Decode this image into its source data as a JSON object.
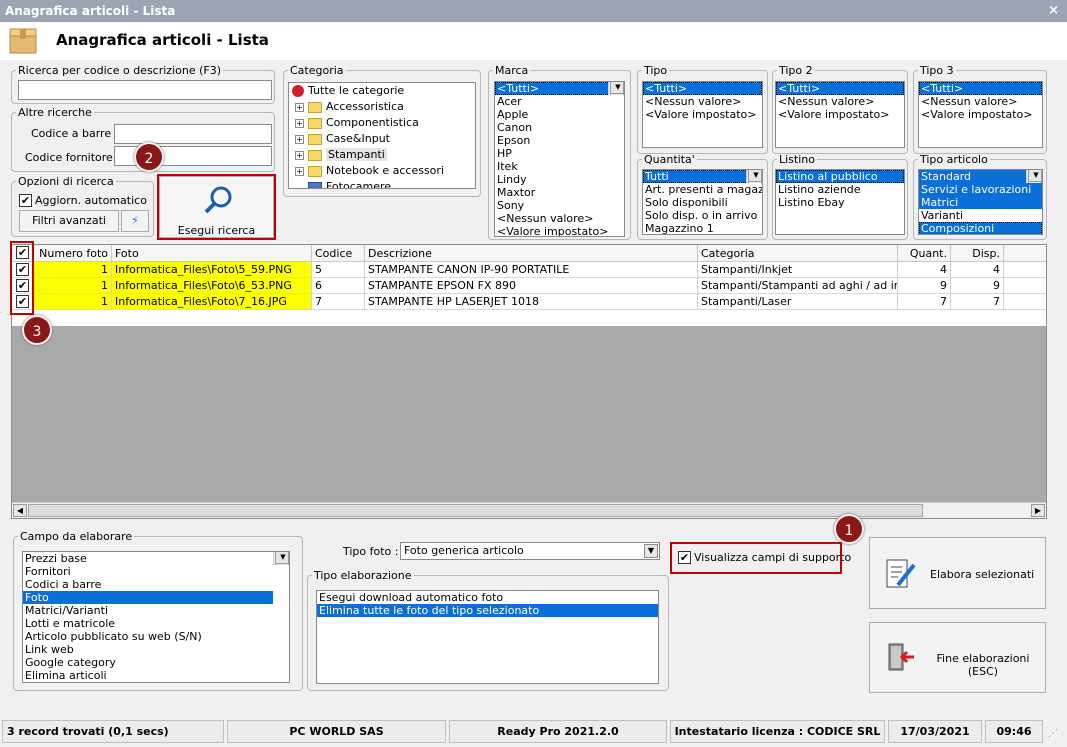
{
  "window": {
    "title": "Anagrafica articoli  - Lista",
    "close": "×"
  },
  "header": {
    "title": "Anagrafica articoli  - Lista"
  },
  "search": {
    "legend": "Ricerca per codice o descrizione (F3)",
    "value": ""
  },
  "other": {
    "legend": "Altre ricerche",
    "barcode_label": "Codice a barre :",
    "supplier_label": "Codice fornitore :"
  },
  "options": {
    "legend": "Opzioni di ricerca",
    "auto_label": "Aggiorn. automatico",
    "adv_label": "Filtri avanzati",
    "lightning": "⚡"
  },
  "run_search": {
    "label": "Esegui ricerca"
  },
  "category": {
    "legend": "Categoria",
    "items": [
      "Tutte le categorie",
      "Accessoristica",
      "Componentistica",
      "Case&Input",
      "Stampanti",
      "Notebook e accessori",
      "Fotocamere"
    ]
  },
  "brand": {
    "legend": "Marca",
    "items": [
      "<Tutti>",
      "Acer",
      "Apple",
      "Canon",
      "Epson",
      "HP",
      "Itek",
      "Lindy",
      "Maxtor",
      "Sony",
      "<Nessun valore>",
      "<Valore impostato>"
    ]
  },
  "tipo": {
    "legend": "Tipo",
    "items": [
      "<Tutti>",
      "<Nessun valore>",
      "<Valore impostato>"
    ]
  },
  "tipo2": {
    "legend": "Tipo 2",
    "items": [
      "<Tutti>",
      "<Nessun valore>",
      "<Valore impostato>"
    ]
  },
  "tipo3": {
    "legend": "Tipo 3",
    "items": [
      "<Tutti>",
      "<Nessun valore>",
      "<Valore impostato>"
    ]
  },
  "quantity": {
    "legend": "Quantita'",
    "items": [
      "Tutti",
      "Art. presenti a magazzino",
      "Solo disponibili",
      "Solo disp. o in arrivo",
      "Magazzino 1"
    ]
  },
  "pricelist": {
    "legend": "Listino",
    "items": [
      "Listino al pubblico",
      "Listino aziende",
      "Listino Ebay"
    ]
  },
  "article_type": {
    "legend": "Tipo articolo",
    "items": [
      "Standard",
      "Servizi e lavorazioni",
      "Matrici",
      "Varianti",
      "Composizioni"
    ]
  },
  "grid": {
    "columns": [
      "Numero foto",
      "Foto",
      "Codice",
      "Descrizione",
      "Categoria",
      "Quant.",
      "Disp."
    ],
    "rows": [
      {
        "n": "1",
        "foto": "Informatica_Files\\Foto\\5_59.PNG",
        "code": "5",
        "desc": "STAMPANTE CANON IP-90 PORTATILE",
        "cat": "Stampanti/Inkjet",
        "q": "4",
        "d": "4"
      },
      {
        "n": "1",
        "foto": "Informatica_Files\\Foto\\6_53.PNG",
        "code": "6",
        "desc": "STAMPANTE EPSON FX 890",
        "cat": "Stampanti/Stampanti ad aghi / ad imp...",
        "q": "9",
        "d": "9"
      },
      {
        "n": "1",
        "foto": "Informatica_Files\\Foto\\7_16.JPG",
        "code": "7",
        "desc": "STAMPANTE HP LASERJET 1018",
        "cat": "Stampanti/Laser",
        "q": "7",
        "d": "7"
      }
    ]
  },
  "field": {
    "legend": "Campo da elaborare",
    "items": [
      "Prezzi base",
      "Fornitori",
      "Codici a barre",
      "Foto",
      "Matrici/Varianti",
      "Lotti e matricole",
      "Articolo pubblicato su web (S/N)",
      "Link web",
      "Google category",
      "Elimina articoli"
    ]
  },
  "photo_type": {
    "label": "Tipo foto :",
    "value": "Foto generica articolo"
  },
  "support": {
    "label": "Visualizza campi di supporto"
  },
  "elab": {
    "legend": "Tipo elaborazione",
    "items": [
      "Esegui download automatico foto",
      "Elimina tutte le foto del tipo selezionato"
    ]
  },
  "actions": {
    "process": "Elabora selezionati",
    "end": "Fine elaborazioni (ESC)"
  },
  "badges": [
    "1",
    "2",
    "3"
  ],
  "status": {
    "records": "3 record trovati (0,1 secs)",
    "company": "PC WORLD SAS",
    "version": "Ready Pro 2021.2.0",
    "license": "Intestatario licenza : CODICE SRL",
    "date": "17/03/2021",
    "time": "09:46"
  }
}
